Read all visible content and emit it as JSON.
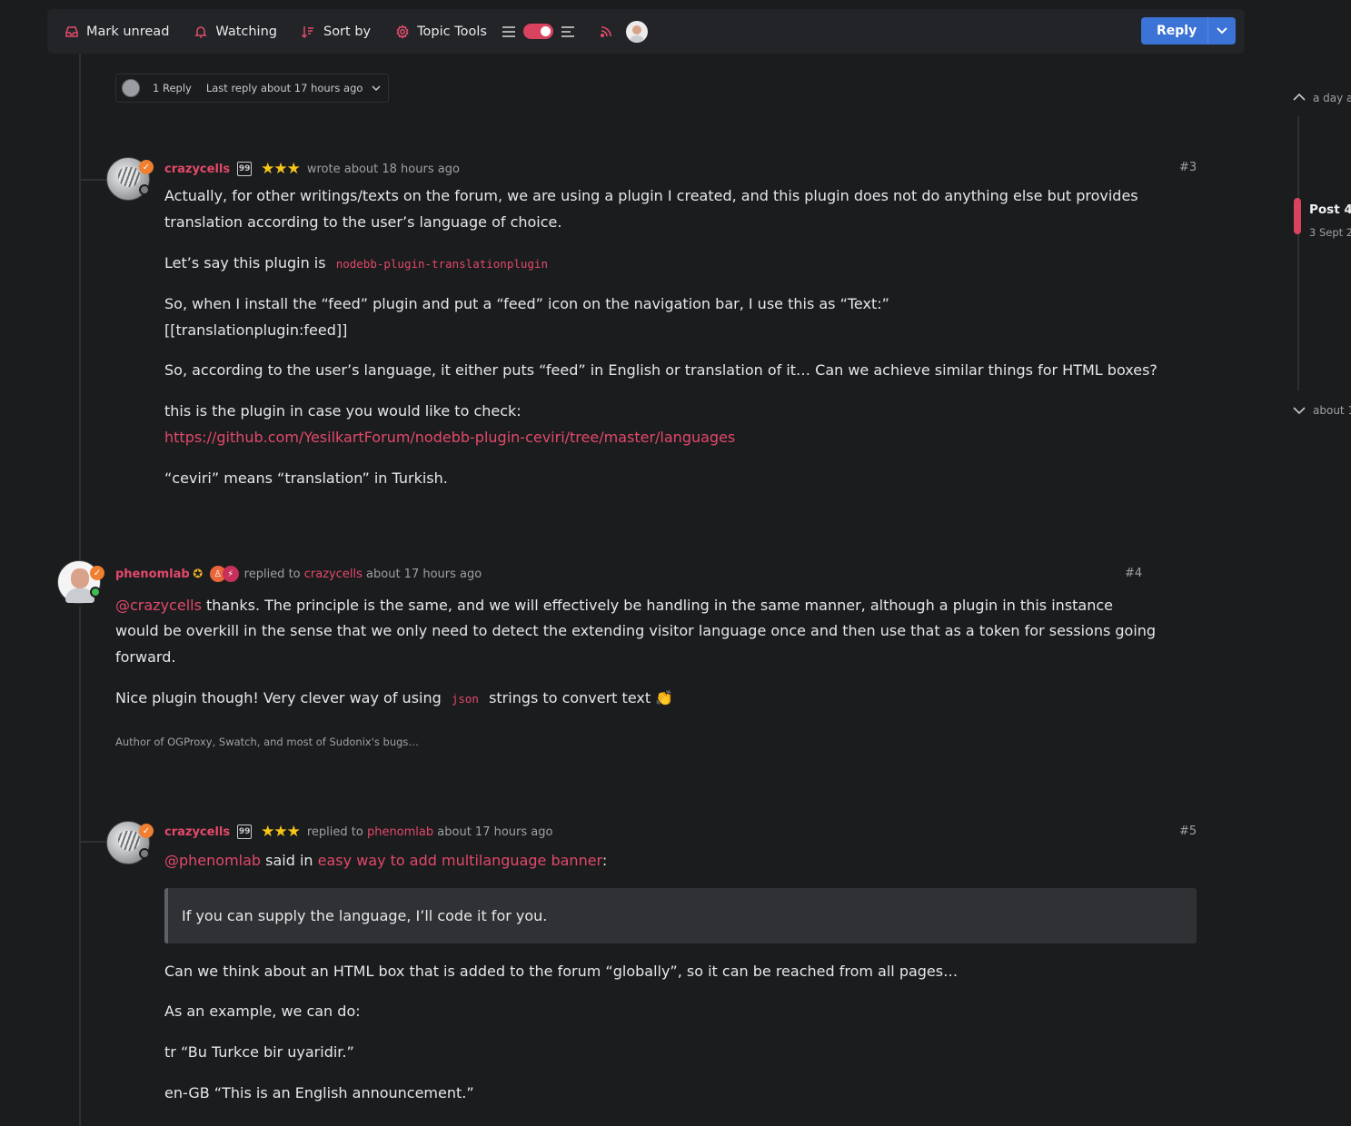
{
  "toolbar": {
    "mark_unread": "Mark unread",
    "watching": "Watching",
    "sort_by": "Sort by",
    "topic_tools": "Topic Tools",
    "reply": "Reply"
  },
  "reply_summary": {
    "count": "1 Reply",
    "last": "Last reply about 17 hours ago"
  },
  "posts": [
    {
      "user": "crazycells",
      "action": "wrote",
      "time": "about 18 hours ago",
      "number": "#3",
      "paragraphs": {
        "p1": "Actually, for other writings/texts on the forum, we are using a plugin I created, and this plugin does not do anything else but provides translation according to the user’s language of choice.",
        "p2_text": "Let’s say this plugin is",
        "p2_code": "nodebb-plugin-translationplugin",
        "p3a": "So, when I install the “feed” plugin and put a “feed” icon on the navigation bar, I use this as “Text:”",
        "p3b": "[[translationplugin:feed]]",
        "p4": "So, according to the user’s language, it either puts “feed” in English or translation of it… Can we achieve similar things for HTML boxes?",
        "p5": "this is the plugin in case you would like to check:",
        "p5_link": "https://github.com/YesilkartForum/nodebb-plugin-ceviri/tree/master/languages",
        "p6": "“ceviri” means “translation” in Turkish."
      }
    },
    {
      "user": "phenomlab",
      "action": "replied to",
      "reply_to": "crazycells",
      "time": "about 17 hours ago",
      "number": "#4",
      "paragraphs": {
        "mention": "@crazycells",
        "p1_rest": " thanks. The principle is the same, and we will effectively be handling in the same manner, although a plugin in this instance",
        "p1_line2": "would be overkill in the sense that we only need to detect the extending visitor language once and then use that as a token for sessions going",
        "p1_line3": "forward.",
        "p2_text": "Nice plugin though! Very clever way of using",
        "p2_code": "json",
        "p2_rest": "strings to convert text",
        "p2_emoji": "👏"
      },
      "signature": "Author of OGProxy, Swatch, and most of Sudonix's bugs…"
    },
    {
      "user": "crazycells",
      "action": "replied to",
      "reply_to": "phenomlab",
      "time": "about 17 hours ago",
      "number": "#5",
      "paragraphs": {
        "mention": "@phenomlab",
        "said_in": " said in ",
        "topic_link": "easy way to add multilanguage banner",
        "colon": ":",
        "quote": "If you can supply the language, I’ll code it for you.",
        "p2": "Can we think about an HTML box that is added to the forum “globally”, so it can be reached from all pages…",
        "p3": "As an example, we can do:",
        "p4": "tr “Bu Turkce bir uyaridir.”",
        "p5": "en-GB “This is an English announcement.”"
      }
    }
  ],
  "timeline": {
    "top": "a day a",
    "post": "Post 4",
    "date": "3 Sept 2",
    "bottom": "about 1"
  },
  "colors": {
    "accent": "#e2496a",
    "reply_button": "#3b73d6",
    "background": "#1b1c1e"
  }
}
